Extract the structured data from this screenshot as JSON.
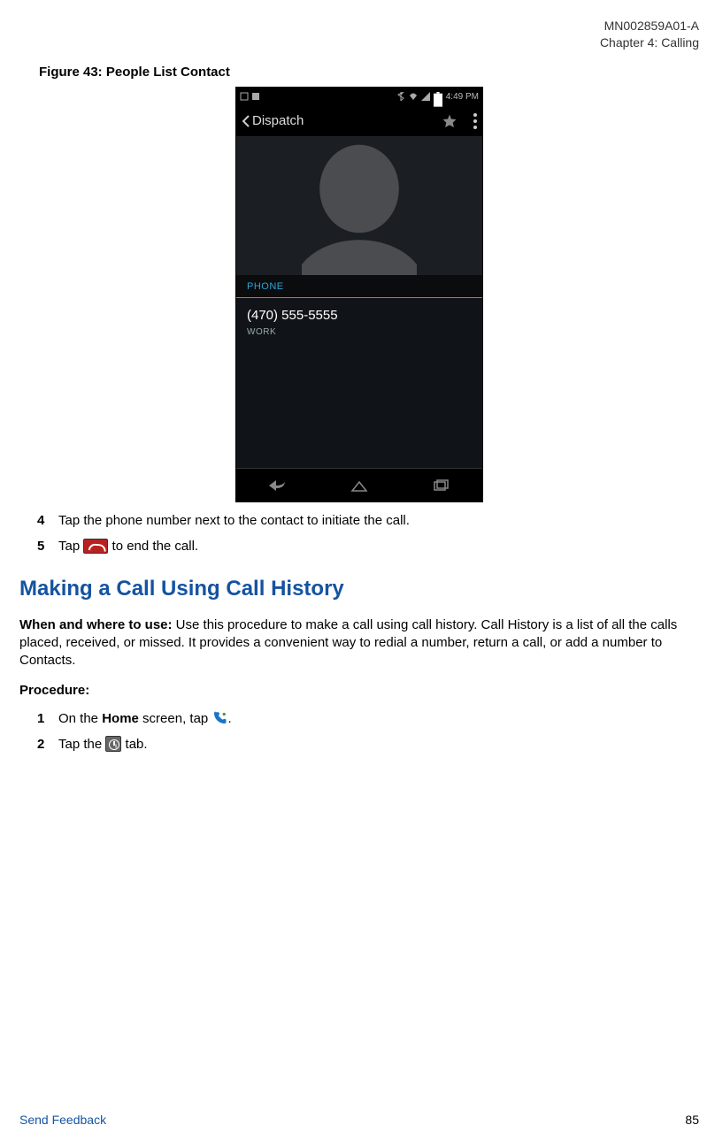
{
  "header": {
    "doc_id": "MN002859A01-A",
    "chapter": "Chapter 4:  Calling"
  },
  "figure": {
    "caption": "Figure 43: People List Contact",
    "statusbar_time": "4:49 PM",
    "appbar_back_label": "Dispatch",
    "section_label": "PHONE",
    "phone_number": "(470) 555-5555",
    "phone_type": "WORK"
  },
  "steps_a": [
    {
      "num": "4",
      "text": "Tap the phone number next to the contact to initiate the call."
    },
    {
      "num": "5",
      "before": "Tap ",
      "after": " to end the call."
    }
  ],
  "section2": {
    "title": "Making a Call Using Call History",
    "intro_label": "When and where to use:",
    "intro_body": " Use this procedure to make a call using call history. Call History is a list of all the calls placed, received, or missed. It provides a convenient way to redial a number, return a call, or add a number to Contacts.",
    "procedure_label": "Procedure:",
    "steps": [
      {
        "num": "1",
        "before": "On the ",
        "bold": "Home",
        "mid": " screen, tap ",
        "after": "."
      },
      {
        "num": "2",
        "before": "Tap the ",
        "after": " tab."
      }
    ]
  },
  "footer": {
    "feedback": "Send Feedback",
    "page": "85"
  }
}
